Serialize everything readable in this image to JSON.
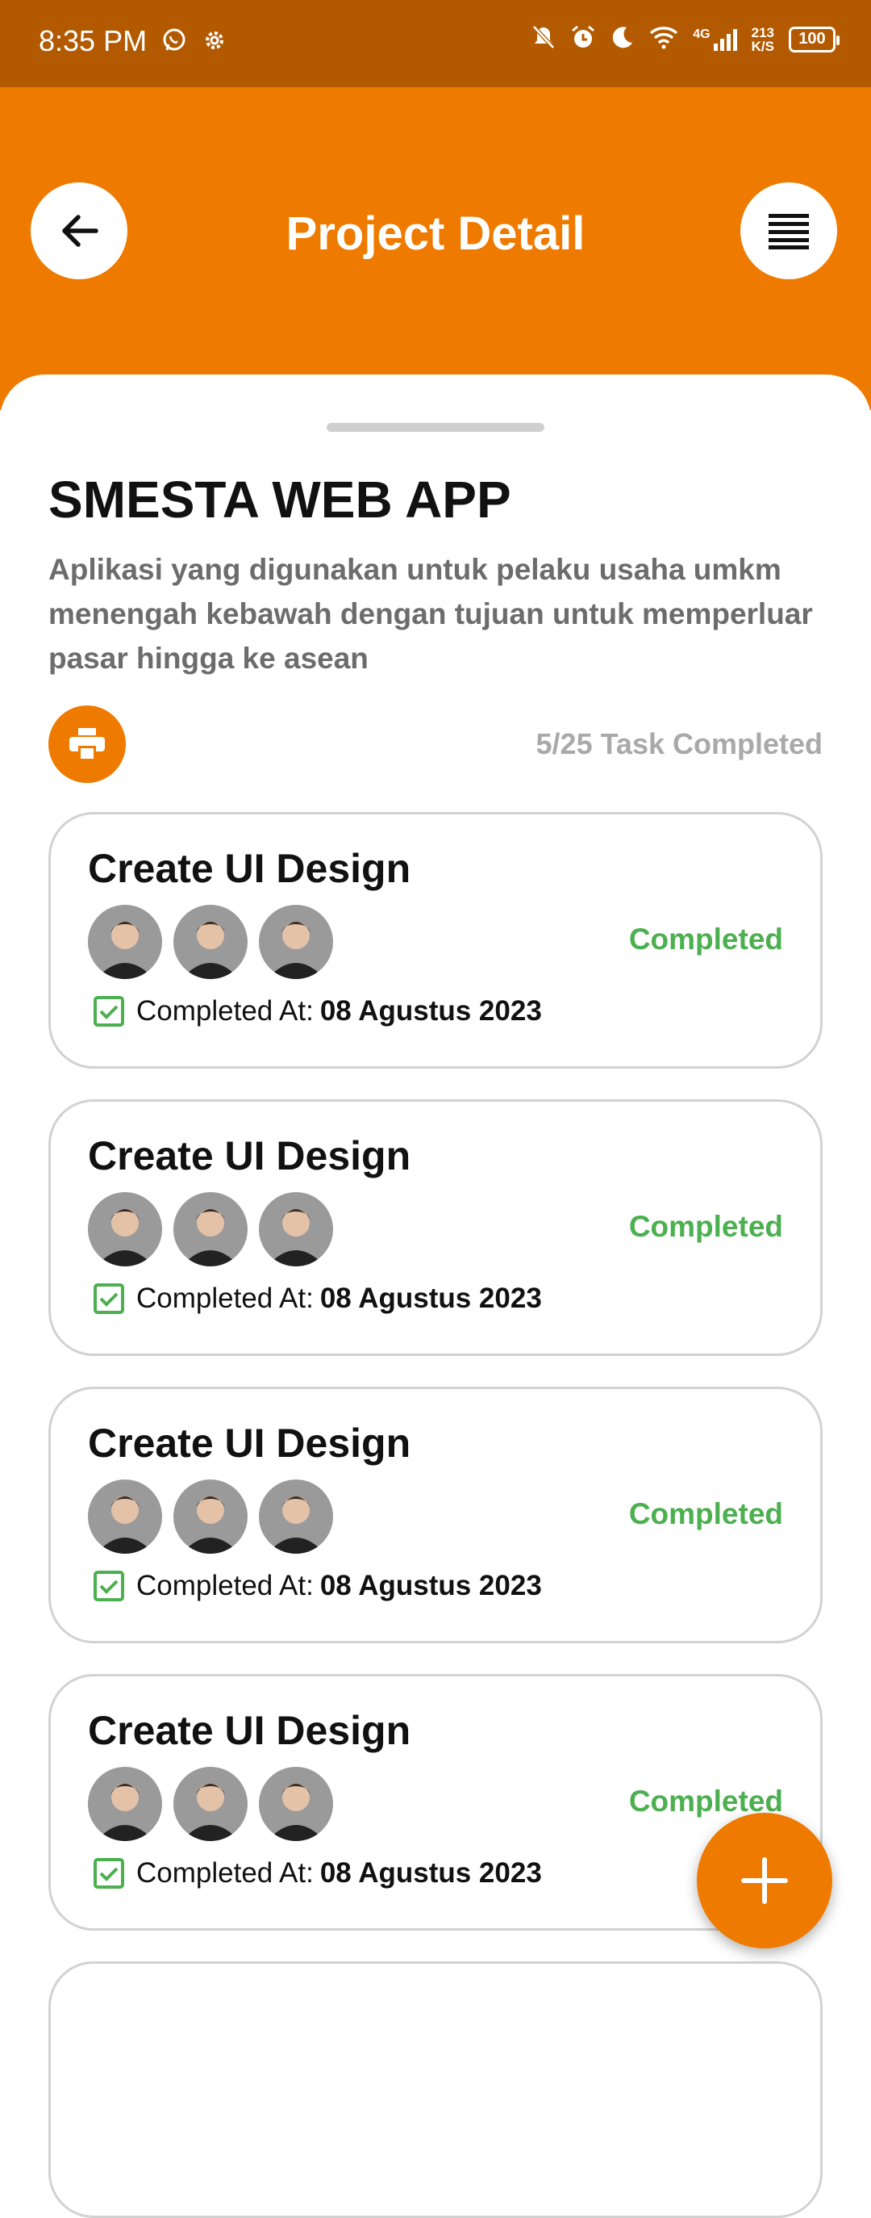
{
  "status_bar": {
    "time": "8:35 PM",
    "left_icons": [
      "whatsapp-icon",
      "settings-icon"
    ],
    "right_icons": [
      "mute-icon",
      "alarm-icon",
      "moon-icon",
      "wifi-icon",
      "signal-4g-icon"
    ],
    "network_type": "4G",
    "net_speed_value": "213",
    "net_speed_unit": "K/S",
    "battery": "100"
  },
  "header": {
    "title": "Project Detail",
    "back_icon": "arrow-left-icon",
    "menu_icon": "list-icon",
    "color": "#ef7a00"
  },
  "project": {
    "name": "SMESTA WEB APP",
    "description": "Aplikasi yang digunakan untuk pelaku usaha umkm menengah kebawah dengan tujuan untuk memperluar pasar hingga ke asean",
    "task_count": "5/25 Task Completed",
    "print_icon": "printer-icon"
  },
  "tasks": [
    {
      "title": "Create UI Design",
      "status": "Completed",
      "completed_label": "Completed At:",
      "completed_date": "08 Agustus 2023"
    },
    {
      "title": "Create UI Design",
      "status": "Completed",
      "completed_label": "Completed At:",
      "completed_date": "08 Agustus 2023"
    },
    {
      "title": "Create UI Design",
      "status": "Completed",
      "completed_label": "Completed At:",
      "completed_date": "08 Agustus 2023"
    },
    {
      "title": "Create UI Design",
      "status": "Completed",
      "completed_label": "Completed At:",
      "completed_date": "08 Agustus 2023"
    }
  ],
  "colors": {
    "accent": "#ef7a00",
    "status_bar": "#b35a00",
    "completed": "#4caf50"
  },
  "fab_icon": "plus-icon"
}
